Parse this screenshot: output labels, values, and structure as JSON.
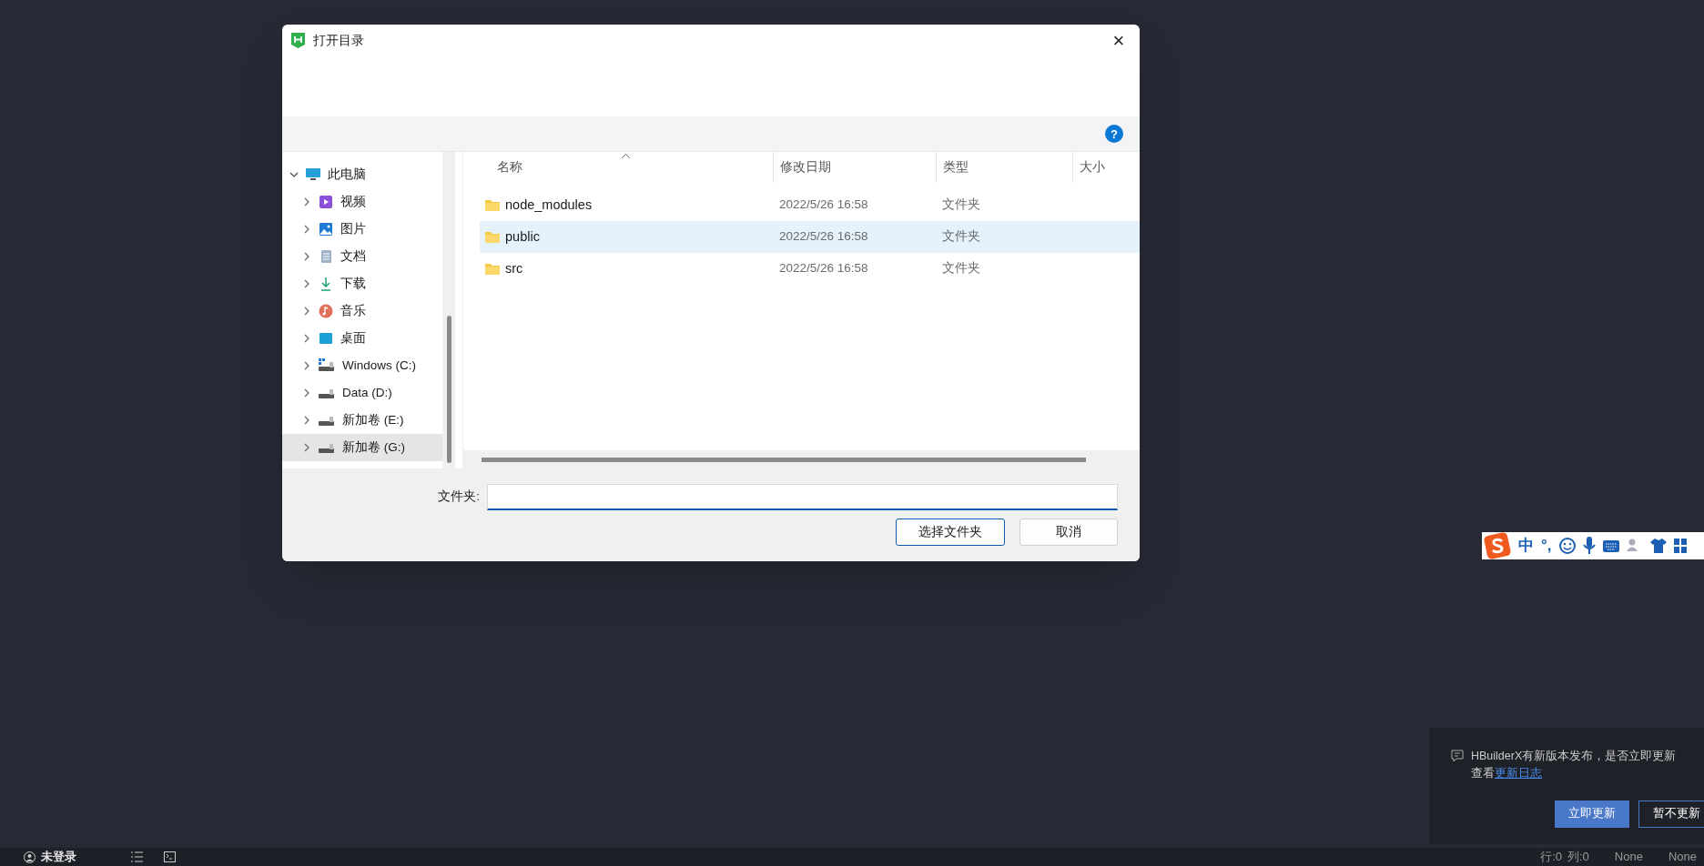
{
  "dialog": {
    "title": "打开目录",
    "close": "×",
    "help": "?",
    "nav": [
      {
        "label": "此电脑",
        "expanded": true,
        "selected": false,
        "children": [
          {
            "label": "视频",
            "expanded": false,
            "selected": false
          },
          {
            "label": "图片",
            "expanded": false,
            "selected": false
          },
          {
            "label": "文档",
            "expanded": false,
            "selected": false
          },
          {
            "label": "下载",
            "expanded": false,
            "selected": false
          },
          {
            "label": "音乐",
            "expanded": false,
            "selected": false
          },
          {
            "label": "桌面",
            "expanded": false,
            "selected": false
          },
          {
            "label": "Windows (C:)",
            "expanded": false,
            "selected": false
          },
          {
            "label": "Data (D:)",
            "expanded": false,
            "selected": false
          },
          {
            "label": "新加卷 (E:)",
            "expanded": false,
            "selected": false
          },
          {
            "label": "新加卷 (G:)",
            "expanded": false,
            "selected": true
          }
        ]
      }
    ],
    "columns": [
      {
        "label": "名称",
        "sorted": true
      },
      {
        "label": "修改日期",
        "sorted": false
      },
      {
        "label": "类型",
        "sorted": false
      },
      {
        "label": "大小",
        "sorted": false
      }
    ],
    "rows": [
      {
        "name": "node_modules",
        "date": "2022/5/26 16:58",
        "type": "文件夹",
        "selected": false
      },
      {
        "name": "public",
        "date": "2022/5/26 16:58",
        "type": "文件夹",
        "selected": true
      },
      {
        "name": "src",
        "date": "2022/5/26 16:58",
        "type": "文件夹",
        "selected": false
      }
    ],
    "folder_field": {
      "label": "文件夹:"
    },
    "buttons": [
      {
        "label": "选择文件夹",
        "primary": true
      },
      {
        "label": "取消",
        "primary": false
      }
    ]
  },
  "ime_bar": {
    "mode": "中",
    "punct": "°,"
  },
  "notification": {
    "message": "HBuilderX有新版本发布，是否立即更新",
    "prefix": "查看",
    "link": "更新日志",
    "buttons": [
      {
        "label": "立即更新",
        "primary": true
      },
      {
        "label": "暂不更新",
        "primary": false
      }
    ]
  },
  "status_bar": {
    "user": "未登录",
    "right": [
      "行:0",
      "列:0",
      "None",
      "None"
    ]
  }
}
